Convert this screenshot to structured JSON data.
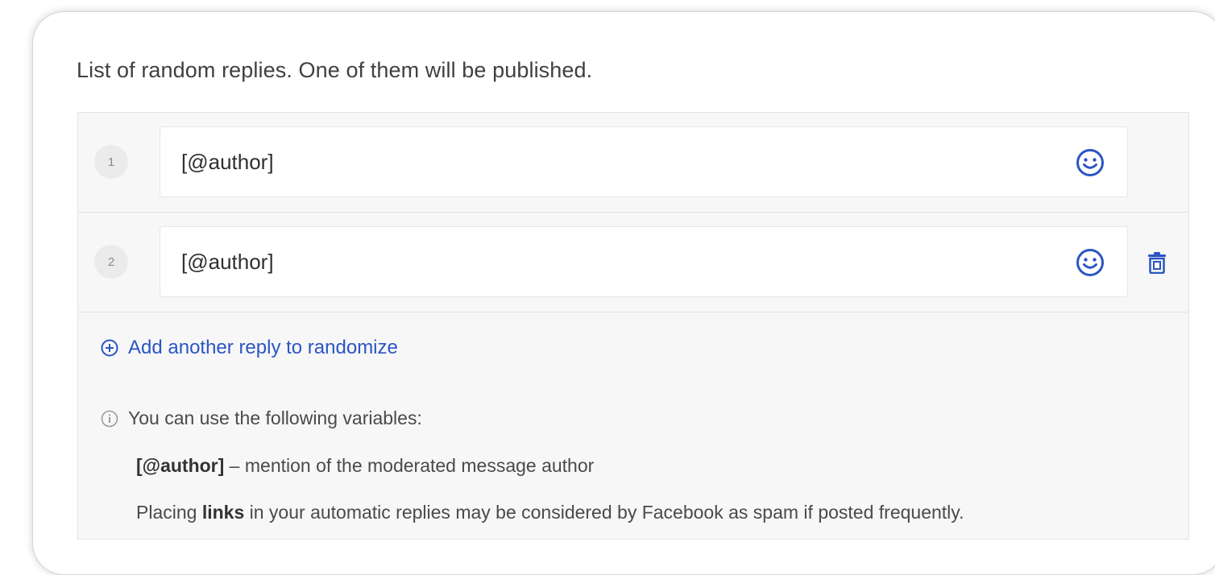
{
  "heading": "List of random replies. One of them will be published.",
  "replies": [
    {
      "number": "1",
      "value": "[@author]"
    },
    {
      "number": "2",
      "value": "[@author]"
    }
  ],
  "add_reply_label": "Add another reply to randomize",
  "info": {
    "title": "You can use the following variables:",
    "variable_name": "[@author]",
    "variable_desc": " – mention of the moderated message author",
    "warn_prefix": "Placing ",
    "warn_bold": "links",
    "warn_suffix": " in your automatic replies may be considered by Facebook as spam if posted frequently."
  },
  "colors": {
    "accent": "#2b55c4",
    "panel_bg": "#f7f7f7",
    "text": "#404040"
  },
  "icons": {
    "emoji": "smiley-face-icon",
    "delete": "trash-icon",
    "add": "plus-circle-icon",
    "info": "info-circle-icon"
  }
}
